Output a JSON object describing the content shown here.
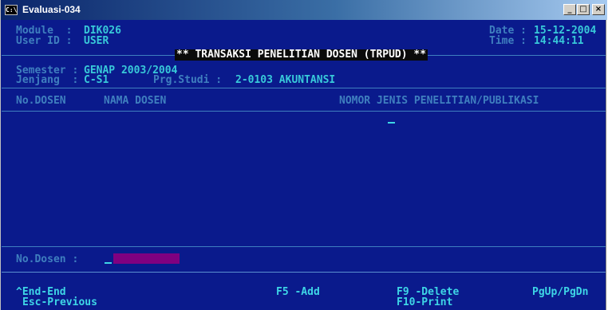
{
  "window": {
    "title": "Evaluasi-034",
    "icon": "console-icon",
    "icon_text": "C:\\",
    "buttons": {
      "minimize": "_",
      "maximize": "□",
      "close": "×"
    }
  },
  "header": {
    "module_label": "Module  :",
    "module_value": "DIK026",
    "userid_label": "User ID :",
    "userid_value": "USER",
    "date_label": "Date :",
    "date_value": "15-12-2004",
    "time_label": "Time :",
    "time_value": "14:44:11",
    "banner": "** TRANSAKSI PENELITIAN DOSEN (TRPUD) **"
  },
  "filters": {
    "semester_label": "Semester :",
    "semester_value": "GENAP 2003/2004",
    "jenjang_label": "Jenjang  :",
    "jenjang_value": "C-S1",
    "prodi_label": "Prg.Studi :",
    "prodi_value": "2-0103 AKUNTANSI"
  },
  "table": {
    "columns": [
      "No.DOSEN",
      "NAMA DOSEN",
      "NOMOR JENIS PENELITIAN/PUBLIKASI"
    ],
    "rows": []
  },
  "input": {
    "label": "No.Dosen :",
    "value": ""
  },
  "footer": {
    "end": "^End-End",
    "esc": "Esc-Previous",
    "f5": "F5 -Add",
    "f9": "F9 -Delete",
    "f10": "F10-Print",
    "pg": "PgUp/PgDn"
  }
}
